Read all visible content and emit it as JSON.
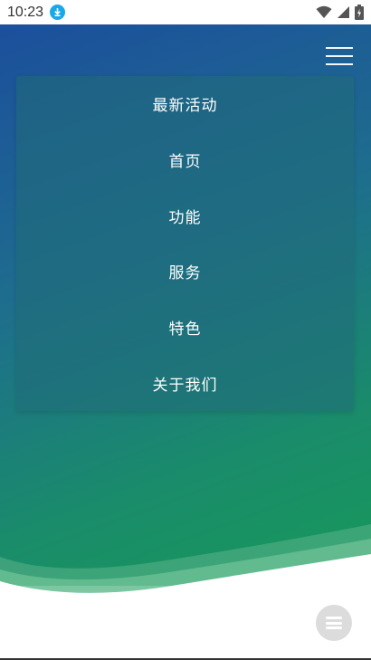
{
  "status_bar": {
    "time": "10:23"
  },
  "header": {
    "menu_icon": "hamburger-menu-icon"
  },
  "menu": {
    "items": [
      {
        "label": "最新活动"
      },
      {
        "label": "首页"
      },
      {
        "label": "功能"
      },
      {
        "label": "服务"
      },
      {
        "label": "特色"
      },
      {
        "label": "关于我们"
      }
    ]
  },
  "fab": {
    "icon": "list-icon"
  },
  "colors": {
    "gradient_start": "#1c4f9c",
    "gradient_end": "#17995a",
    "download_badge": "#19a9e6",
    "fab_bg": "#dcdcdc"
  }
}
